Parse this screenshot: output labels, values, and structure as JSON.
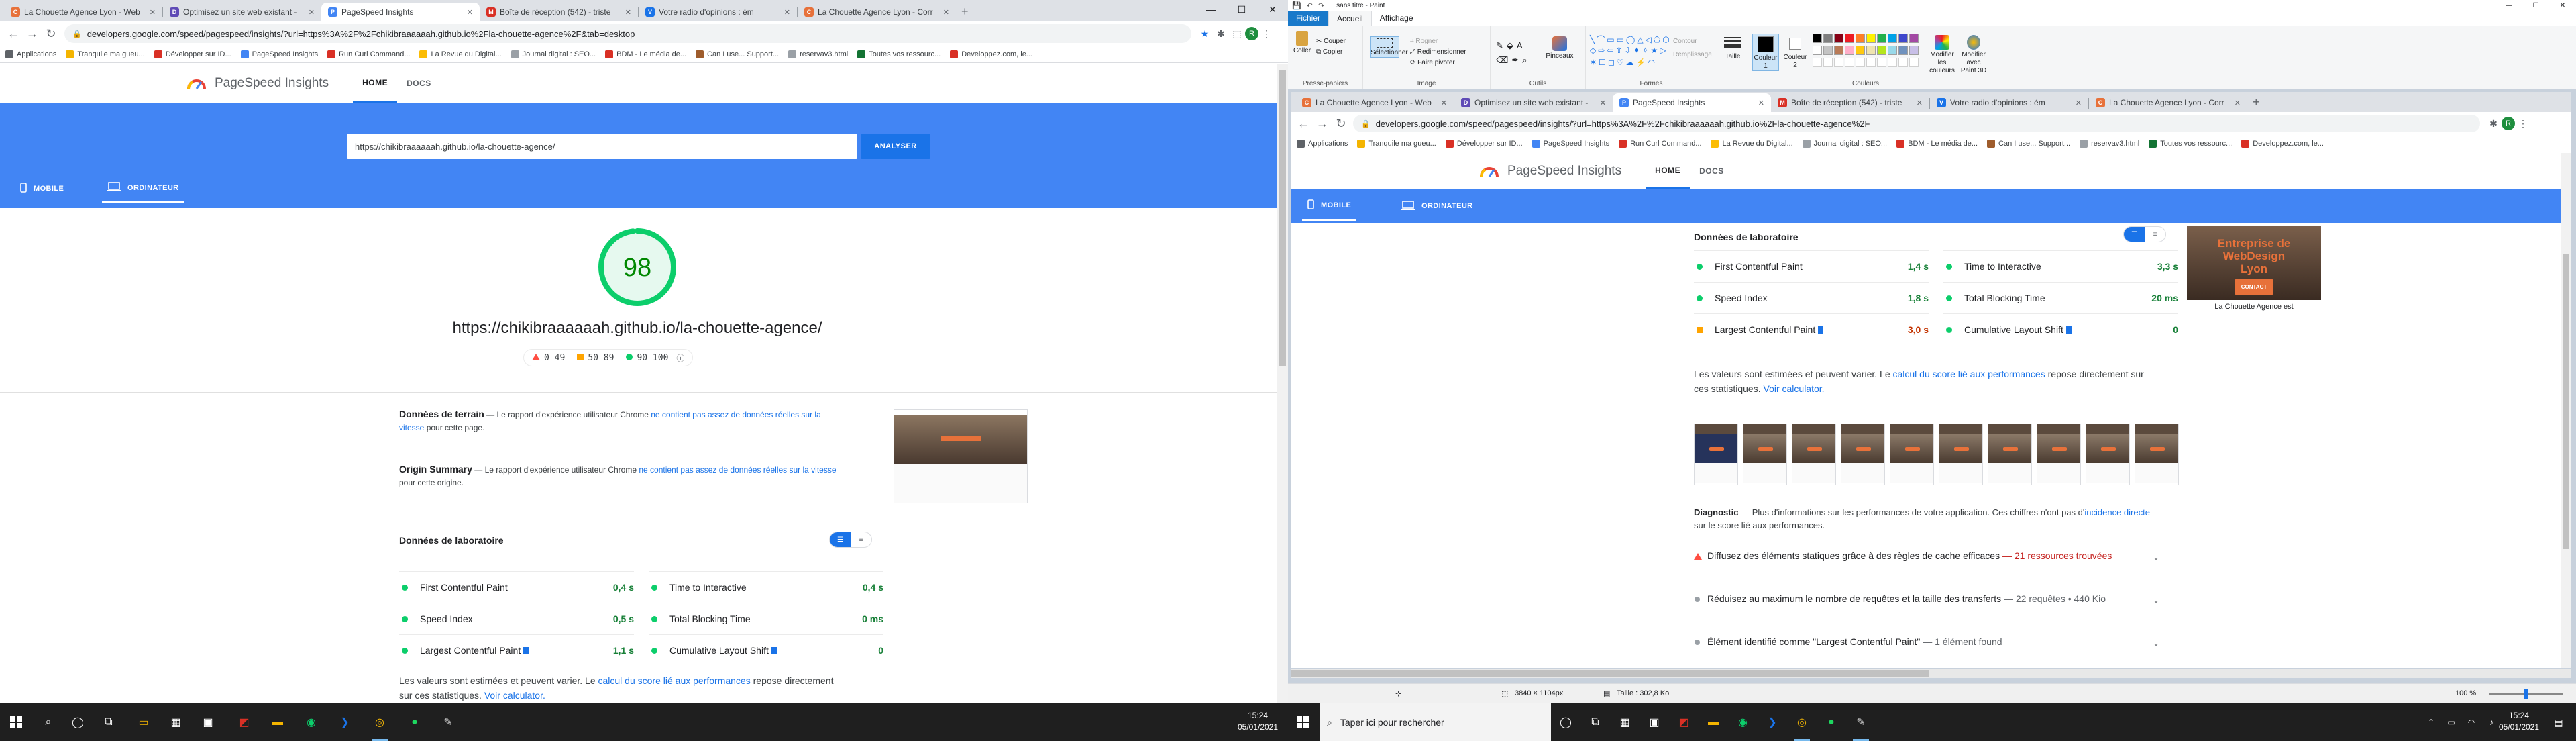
{
  "left_browser": {
    "tabs": [
      {
        "title": "La Chouette Agence Lyon - Web",
        "icon_color": "#e7713a",
        "icon_char": "C"
      },
      {
        "title": "Optimisez un site web existant -",
        "icon_color": "#5f4bb6",
        "icon_char": "D"
      },
      {
        "title": "PageSpeed Insights",
        "icon_color": "#4285f4",
        "icon_char": "P",
        "active": true
      },
      {
        "title": "Boîte de réception (542) - triste",
        "icon_color": "#d93025",
        "icon_char": "M"
      },
      {
        "title": "Votre radio d'opinions : ém",
        "icon_color": "#1a73e8",
        "icon_char": "V"
      },
      {
        "title": "La Chouette Agence Lyon - Corr",
        "icon_color": "#e7713a",
        "icon_char": "C"
      }
    ],
    "new_tab": "+",
    "url": "developers.google.com/speed/pagespeed/insights/?url=https%3A%2F%2Fchikibraaaaaah.github.io%2Fla-chouette-agence%2F&tab=desktop",
    "bookmarks": [
      {
        "label": "Applications",
        "color": "#5f6368"
      },
      {
        "label": "Tranquile ma gueu...",
        "color": "#f4b400"
      },
      {
        "label": "Développer sur ID...",
        "color": "#d93025"
      },
      {
        "label": "PageSpeed Insights",
        "color": "#4285f4"
      },
      {
        "label": "Run Curl Command...",
        "color": "#d93025"
      },
      {
        "label": "La Revue du Digital...",
        "color": "#fbbc04"
      },
      {
        "label": "Journal digital : SEO...",
        "color": "#9aa0a6"
      },
      {
        "label": "BDM - Le média de...",
        "color": "#d93025"
      },
      {
        "label": "Can I use... Support...",
        "color": "#9e5c2c"
      },
      {
        "label": "reservav3.html",
        "color": "#9aa0a6"
      },
      {
        "label": "Toutes vos ressourc...",
        "color": "#137333"
      },
      {
        "label": "Developpez.com, le...",
        "color": "#d93025"
      }
    ]
  },
  "psi": {
    "brand": "PageSpeed Insights",
    "nav_home": "HOME",
    "nav_docs": "DOCS",
    "input_value": "https://chikibraaaaaah.github.io/la-chouette-agence/",
    "analyze": "ANALYSER",
    "tab_mobile": "MOBILE",
    "tab_desktop": "ORDINATEUR",
    "score": 98,
    "score_color": "#0cce6b",
    "result_url": "https://chikibraaaaaah.github.io/la-chouette-agence/",
    "legend": [
      {
        "label": "0–49",
        "color": "#ff4e42",
        "shape": "triangle"
      },
      {
        "label": "50–89",
        "color": "#ffa400",
        "shape": "square"
      },
      {
        "label": "90–100",
        "color": "#0cce6b",
        "shape": "circle"
      }
    ],
    "field_title": "Données de terrain",
    "field_pre": " — Le rapport d'expérience utilisateur Chrome ",
    "field_link": "ne contient pas assez de données réelles sur la vitesse",
    "field_post": " pour cette page.",
    "origin_title": "Origin Summary",
    "origin_pre": " — Le rapport d'expérience utilisateur Chrome ",
    "origin_link": "ne contient pas assez de données réelles sur la vitesse",
    "origin_post": " pour cette origine.",
    "lab_title": "Données de laboratoire",
    "desktop_metrics": [
      {
        "name": "First Contentful Paint",
        "value": "0,4 s",
        "status": "pass"
      },
      {
        "name": "Time to Interactive",
        "value": "0,4 s",
        "status": "pass"
      },
      {
        "name": "Speed Index",
        "value": "0,5 s",
        "status": "pass"
      },
      {
        "name": "Total Blocking Time",
        "value": "0 ms",
        "status": "pass"
      },
      {
        "name": "Largest Contentful Paint",
        "value": "1,1 s",
        "status": "pass",
        "flag": true
      },
      {
        "name": "Cumulative Layout Shift",
        "value": "0",
        "status": "pass",
        "flag": true
      }
    ],
    "estimate_pre": "Les valeurs sont estimées et peuvent varier. Le ",
    "estimate_link": "calcul du score lié aux performances",
    "estimate_mid": " repose directement sur ces statistiques. ",
    "estimate_link2": "Voir calculator."
  },
  "paint": {
    "title": "sans titre - Paint",
    "menu": [
      "Fichier",
      "Accueil",
      "Affichage"
    ],
    "groups": {
      "clipboard": {
        "label": "Presse-papiers",
        "paste": "Coller",
        "cut": "Couper",
        "copy": "Copier"
      },
      "image": {
        "label": "Image",
        "select": "Sélectionner",
        "crop": "Rogner",
        "resize": "Redimensionner",
        "rotate": "Faire pivoter"
      },
      "tools": {
        "label": "Outils",
        "brushes": "Pinceaux"
      },
      "shapes": {
        "label": "Formes",
        "outline": "Contour",
        "fill": "Remplissage"
      },
      "size": "Taille",
      "colors": {
        "label": "Couleurs",
        "color1": "Couleur 1",
        "color2": "Couleur 2",
        "edit": "Modifier les couleurs",
        "paint3d": "Modifier avec Paint 3D"
      }
    },
    "palette": [
      "#000000",
      "#7f7f7f",
      "#880015",
      "#ed1c24",
      "#ff7f27",
      "#fff200",
      "#22b14c",
      "#00a2e8",
      "#3f48cc",
      "#a349a4",
      "#ffffff",
      "#c3c3c3",
      "#b97a57",
      "#ffaec9",
      "#ffc90e",
      "#efe4b0",
      "#b5e61d",
      "#99d9ea",
      "#7092be",
      "#c8bfe7"
    ],
    "status_dims": "3840 × 1104px",
    "status_size": "Taille : 302,8 Ko",
    "zoom": "100 %"
  },
  "right_browser": {
    "tabs": [
      {
        "title": "La Chouette Agence Lyon - Web",
        "icon_color": "#e7713a",
        "icon_char": "C"
      },
      {
        "title": "Optimisez un site web existant -",
        "icon_color": "#5f4bb6",
        "icon_char": "D"
      },
      {
        "title": "PageSpeed Insights",
        "icon_color": "#4285f4",
        "icon_char": "P",
        "active": true
      },
      {
        "title": "Boîte de réception (542) - triste",
        "icon_color": "#d93025",
        "icon_char": "M"
      },
      {
        "title": "Votre radio d'opinions : ém",
        "icon_color": "#1a73e8",
        "icon_char": "V"
      },
      {
        "title": "La Chouette Agence Lyon - Corr",
        "icon_color": "#e7713a",
        "icon_char": "C"
      }
    ],
    "url": "developers.google.com/speed/pagespeed/insights/?url=https%3A%2F%2Fchikibraaaaaah.github.io%2Fla-chouette-agence%2F",
    "mobile_metrics": [
      {
        "name": "First Contentful Paint",
        "value": "1,4 s",
        "status": "pass"
      },
      {
        "name": "Time to Interactive",
        "value": "3,3 s",
        "status": "pass"
      },
      {
        "name": "Speed Index",
        "value": "1,8 s",
        "status": "pass"
      },
      {
        "name": "Total Blocking Time",
        "value": "20 ms",
        "status": "pass"
      },
      {
        "name": "Largest Contentful Paint",
        "value": "3,0 s",
        "status": "average",
        "flag": true
      },
      {
        "name": "Cumulative Layout Shift",
        "value": "0",
        "status": "pass",
        "flag": true
      }
    ],
    "thumb_line1": "Entreprise de",
    "thumb_line2": "WebDesign",
    "thumb_line3": "Lyon",
    "thumb_btn": "CONTACT",
    "thumb_caption": "La Chouette Agence est",
    "diag_title": "Diagnostic",
    "diag_pre": " — Plus d'informations sur les performances de votre application. Ces chiffres n'ont pas d'",
    "diag_link": "incidence directe",
    "diag_post": " sur le score lié aux performances.",
    "audits": [
      {
        "text": "Diffusez des éléments statiques grâce à des règles de cache efficaces",
        "detail": " — 21 ressources trouvées",
        "severity": "fail"
      },
      {
        "text": "Réduisez au maximum le nombre de requêtes et la taille des transferts",
        "detail": " — 22 requêtes • 440 Kio",
        "severity": "info"
      },
      {
        "text": "Élément identifié comme \"Largest Contentful Paint\"",
        "detail": " — 1 élément found",
        "severity": "info"
      }
    ]
  },
  "taskbar": {
    "search_placeholder": "Taper ici pour rechercher",
    "time": "15:24",
    "date": "05/01/2021"
  }
}
